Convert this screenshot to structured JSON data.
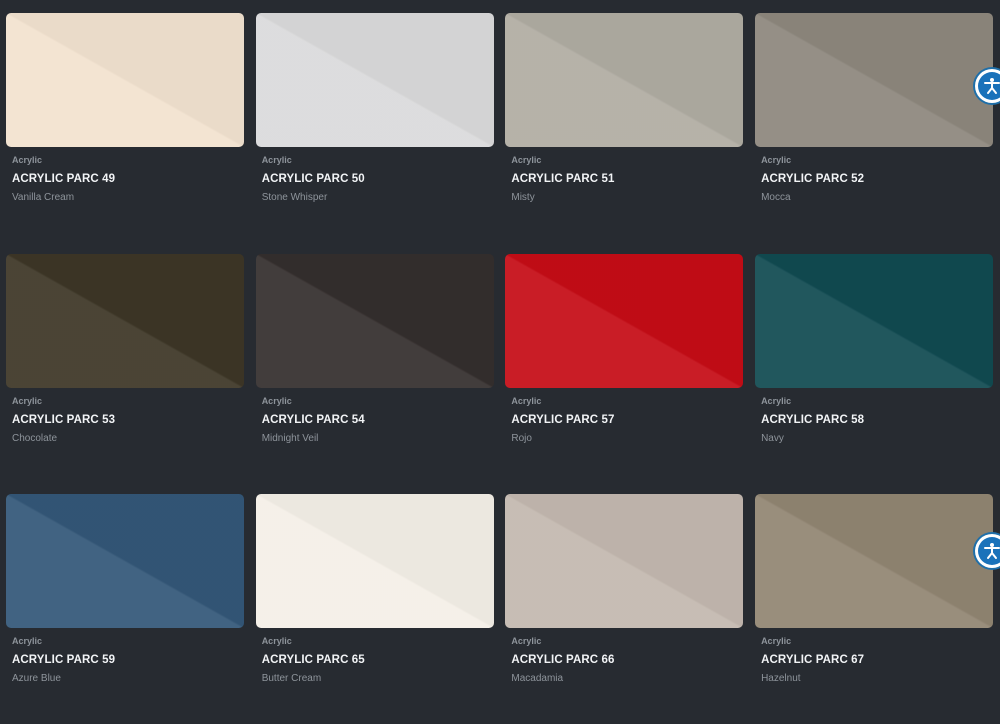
{
  "category_label": "Acrylic",
  "products": [
    {
      "code": "ACRYLIC PARC 49",
      "color_name": "Vanilla Cream",
      "swatch": "#f2e2cf"
    },
    {
      "code": "ACRYLIC PARC 50",
      "color_name": "Stone Whisper",
      "swatch": "#dadadb"
    },
    {
      "code": "ACRYLIC PARC 51",
      "color_name": "Misty",
      "swatch": "#b0aca2"
    },
    {
      "code": "ACRYLIC PARC 52",
      "color_name": "Mocca",
      "swatch": "#8d877d"
    },
    {
      "code": "ACRYLIC PARC 53",
      "color_name": "Chocolate",
      "swatch": "#3d3626"
    },
    {
      "code": "ACRYLIC PARC 54",
      "color_name": "Midnight Veil",
      "swatch": "#342e2d"
    },
    {
      "code": "ACRYLIC PARC 57",
      "color_name": "Rojo",
      "swatch": "#c50c16"
    },
    {
      "code": "ACRYLIC PARC 58",
      "color_name": "Navy",
      "swatch": "#104a51"
    },
    {
      "code": "ACRYLIC PARC 59",
      "color_name": "Azure Blue",
      "swatch": "#335778"
    },
    {
      "code": "ACRYLIC PARC 65",
      "color_name": "Butter Cream",
      "swatch": "#f4efe7"
    },
    {
      "code": "ACRYLIC PARC 66",
      "color_name": "Macadamia",
      "swatch": "#c3b8af"
    },
    {
      "code": "ACRYLIC PARC 67",
      "color_name": "Hazelnut",
      "swatch": "#918572"
    }
  ],
  "accessibility_button": {
    "icon": "accessibility-icon",
    "color": "#1a72ba"
  }
}
